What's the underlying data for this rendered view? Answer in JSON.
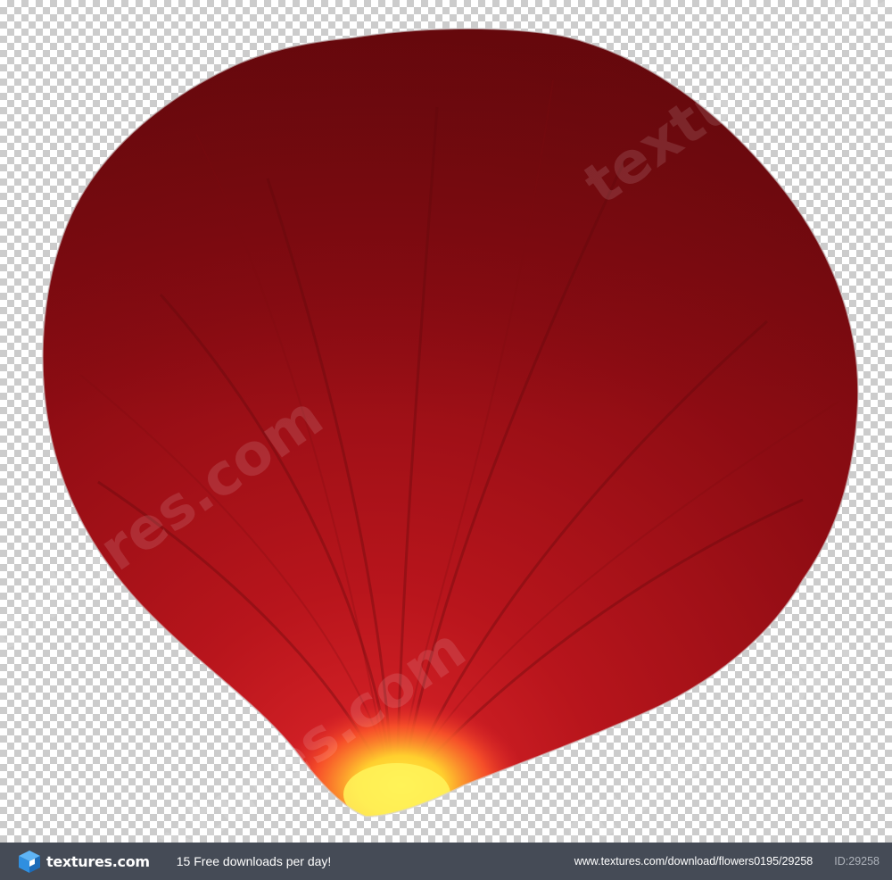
{
  "photo": {
    "subject": "red-rose-petal",
    "colors": {
      "petal_dark": "#6e0a0e",
      "petal_mid": "#9a1218",
      "petal_light": "#c42024",
      "base_yellow": "#f8e23a",
      "base_orange": "#ff7a2a",
      "checker_light": "#ffffff",
      "checker_dark": "#cccccc"
    }
  },
  "watermark": {
    "text": "textures.com"
  },
  "footer": {
    "brand_name": "textures.com",
    "brand_icon": "cube-logo-icon",
    "promo_text": "15 Free downloads per day!",
    "url": "www.textures.com/download/flowers0195/29258",
    "image_id": "ID:29258",
    "colors": {
      "background": "#454b56",
      "logo_blue": "#2f8fe0"
    }
  }
}
